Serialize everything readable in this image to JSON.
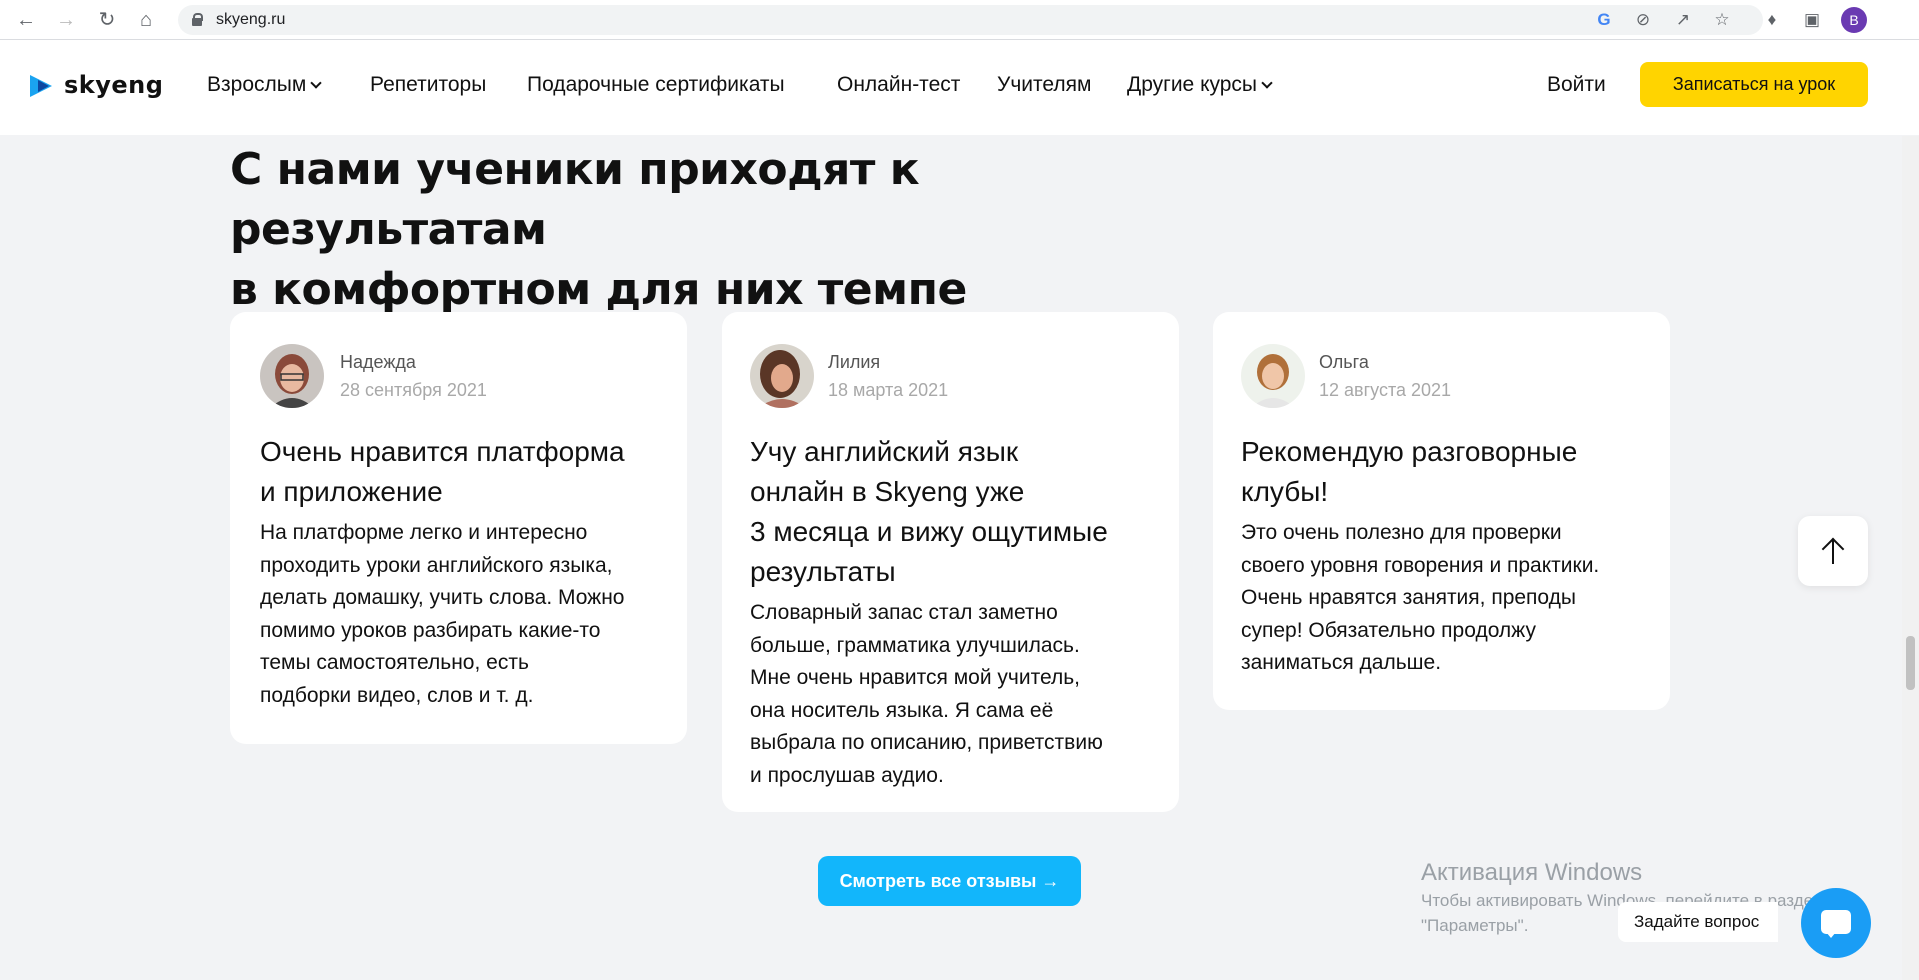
{
  "browser": {
    "url": "skyeng.ru",
    "profile_initial": "B",
    "icons": [
      "back-icon",
      "forward-icon",
      "reload-icon",
      "home-icon",
      "lock-icon",
      "google-icon",
      "eye-off-icon",
      "share-icon",
      "star-icon",
      "extensions-icon",
      "sidepanel-icon"
    ]
  },
  "header": {
    "logo_text": "skyeng",
    "menu": [
      {
        "label": "Взрослым",
        "dropdown": true
      },
      {
        "label": "Репетиторы",
        "dropdown": false
      },
      {
        "label": "Подарочные сертификаты",
        "dropdown": false
      },
      {
        "label": "Онлайн-тест",
        "dropdown": false
      },
      {
        "label": "Учителям",
        "dropdown": false
      },
      {
        "label": "Другие курсы",
        "dropdown": true
      }
    ],
    "login_label": "Войти",
    "cta_label": "Записаться на урок",
    "cta_color": "#ffd400"
  },
  "section": {
    "title_line1": "С нами ученики приходят к результатам",
    "title_line2": "в комфортном для них темпе"
  },
  "reviews": [
    {
      "name": "Надежда",
      "date": "28 сентября 2021",
      "title_lines": [
        "Очень нравится платформа",
        "и приложение"
      ],
      "body_lines": [
        "На платформе легко и интересно",
        "проходить уроки английского языка,",
        "делать домашку, учить слова. Можно",
        "помимо уроков разбирать какие-то",
        "темы самостоятельно, есть",
        "подборки видео, слов и т. д."
      ]
    },
    {
      "name": "Лилия",
      "date": "18 марта 2021",
      "title_lines": [
        "Учу английский язык",
        "онлайн в Skyeng уже",
        "3 месяца и вижу ощутимые",
        "результаты"
      ],
      "body_lines": [
        "Словарный запас стал заметно",
        "больше, грамматика улучшилась.",
        "Мне очень нравится мой учитель,",
        "она носитель языка. Я сама её",
        "выбрала по описанию, приветствию",
        "и прослушав аудио."
      ]
    },
    {
      "name": "Ольга",
      "date": "12 августа 2021",
      "title_lines": [
        "Рекомендую разговорные",
        "клубы!"
      ],
      "body_lines": [
        "Это очень полезно для проверки",
        "своего уровня говорения и практики.",
        "Очень нравятся занятия, преподы",
        "супер! Обязательно продолжу",
        "заниматься дальше."
      ]
    }
  ],
  "all_reviews_label": "Смотреть все отзывы →",
  "all_reviews_color": "#12b6fb",
  "windows_activation": {
    "title": "Активация Windows",
    "line1": "Чтобы активировать Windows, перейдите в раздел",
    "line2": "\"Параметры\"."
  },
  "chat": {
    "ask_label": "Задайте вопрос"
  }
}
